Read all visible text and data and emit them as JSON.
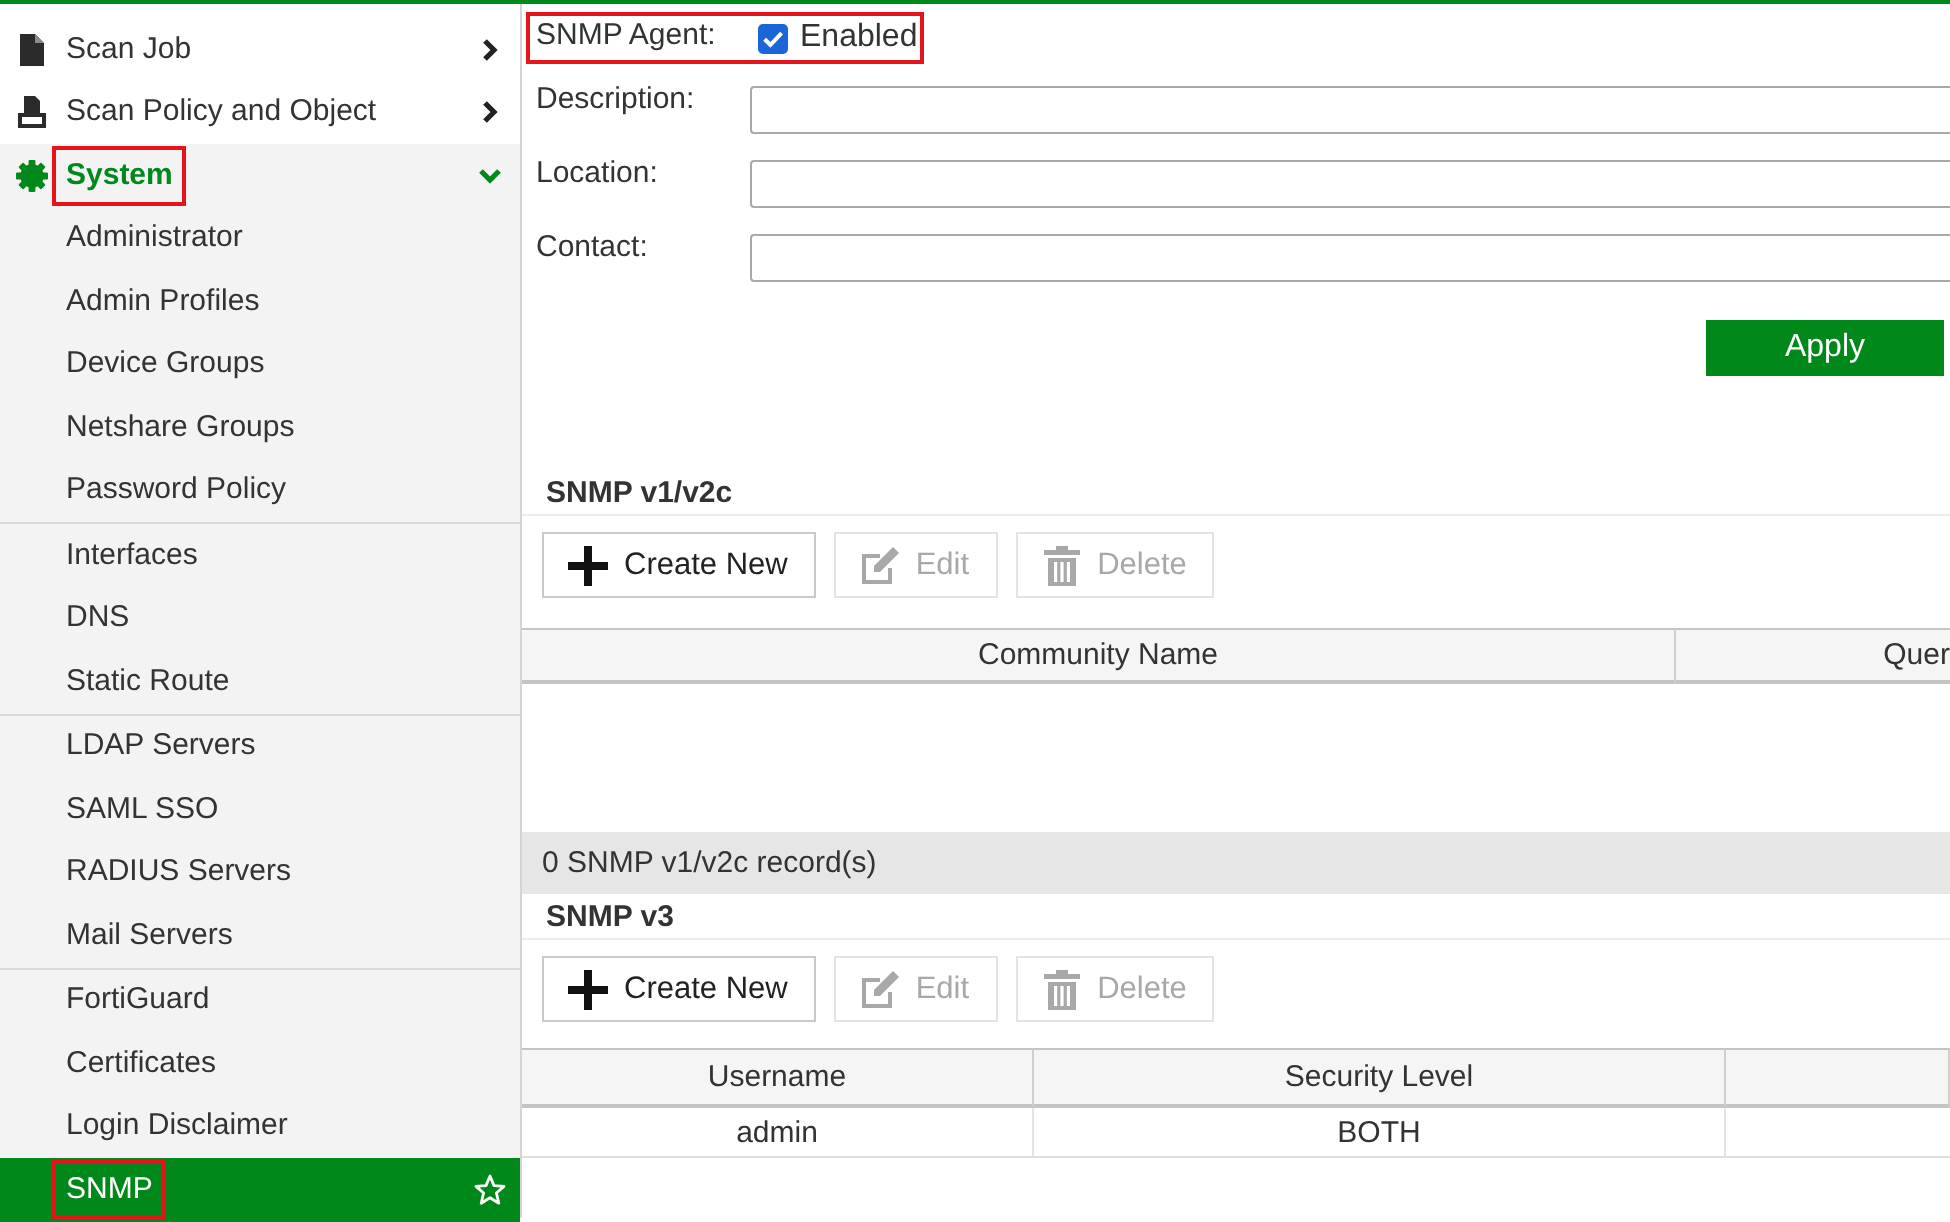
{
  "sidebar": {
    "items": [
      {
        "label": "Scan Job",
        "expanded": false,
        "highlighted": false
      },
      {
        "label": "Scan Policy and Object",
        "expanded": false,
        "highlighted": false
      },
      {
        "label": "System",
        "expanded": true,
        "highlighted": true,
        "children": [
          {
            "children": [
              {
                "label": "Administrator",
                "selected": false,
                "highlighted": false
              },
              {
                "label": "Admin Profiles",
                "selected": false,
                "highlighted": false
              },
              {
                "label": "Device Groups",
                "selected": false,
                "highlighted": false
              },
              {
                "label": "Netshare Groups",
                "selected": false,
                "highlighted": false
              },
              {
                "label": "Password Policy",
                "selected": false,
                "highlighted": false
              }
            ]
          },
          {
            "children": [
              {
                "label": "Interfaces",
                "selected": false,
                "highlighted": false
              },
              {
                "label": "DNS",
                "selected": false,
                "highlighted": false
              },
              {
                "label": "Static Route",
                "selected": false,
                "highlighted": false
              }
            ]
          },
          {
            "children": [
              {
                "label": "LDAP Servers",
                "selected": false,
                "highlighted": false
              },
              {
                "label": "SAML SSO",
                "selected": false,
                "highlighted": false
              },
              {
                "label": "RADIUS Servers",
                "selected": false,
                "highlighted": false
              },
              {
                "label": "Mail Servers",
                "selected": false,
                "highlighted": false
              }
            ]
          },
          {
            "children": [
              {
                "label": "FortiGuard",
                "selected": false,
                "highlighted": false
              },
              {
                "label": "Certificates",
                "selected": false,
                "highlighted": false
              },
              {
                "label": "Login Disclaimer",
                "selected": false,
                "highlighted": false
              },
              {
                "label": "SNMP",
                "selected": true,
                "highlighted": true
              }
            ]
          }
        ]
      }
    ]
  },
  "snmp_agent": {
    "label": "SNMP Agent:",
    "enabled": true,
    "option_label": "Enabled",
    "highlighted": true
  },
  "fields": [
    {
      "label": "Description:"
    },
    {
      "label": "Location:"
    },
    {
      "label": "Contact:"
    }
  ],
  "apply_button": "Apply",
  "sections": [
    {
      "title": "SNMP v1/v2c",
      "toolbar": [
        {
          "label": "Create New",
          "disabled": false
        },
        {
          "label": "Edit",
          "disabled": true
        },
        {
          "label": "Delete",
          "disabled": true
        }
      ],
      "table": {
        "columns": [
          "Community Name",
          "Quer"
        ]
      },
      "footer": "0 SNMP v1/v2c record(s)"
    },
    {
      "title": "SNMP v3",
      "toolbar": [
        {
          "label": "Create New",
          "disabled": false
        },
        {
          "label": "Edit",
          "disabled": true
        },
        {
          "label": "Delete",
          "disabled": true
        }
      ],
      "table": {
        "columns": [
          "Username",
          "Security Level"
        ],
        "rows": [
          [
            "admin",
            "BOTH"
          ]
        ]
      }
    }
  ]
}
